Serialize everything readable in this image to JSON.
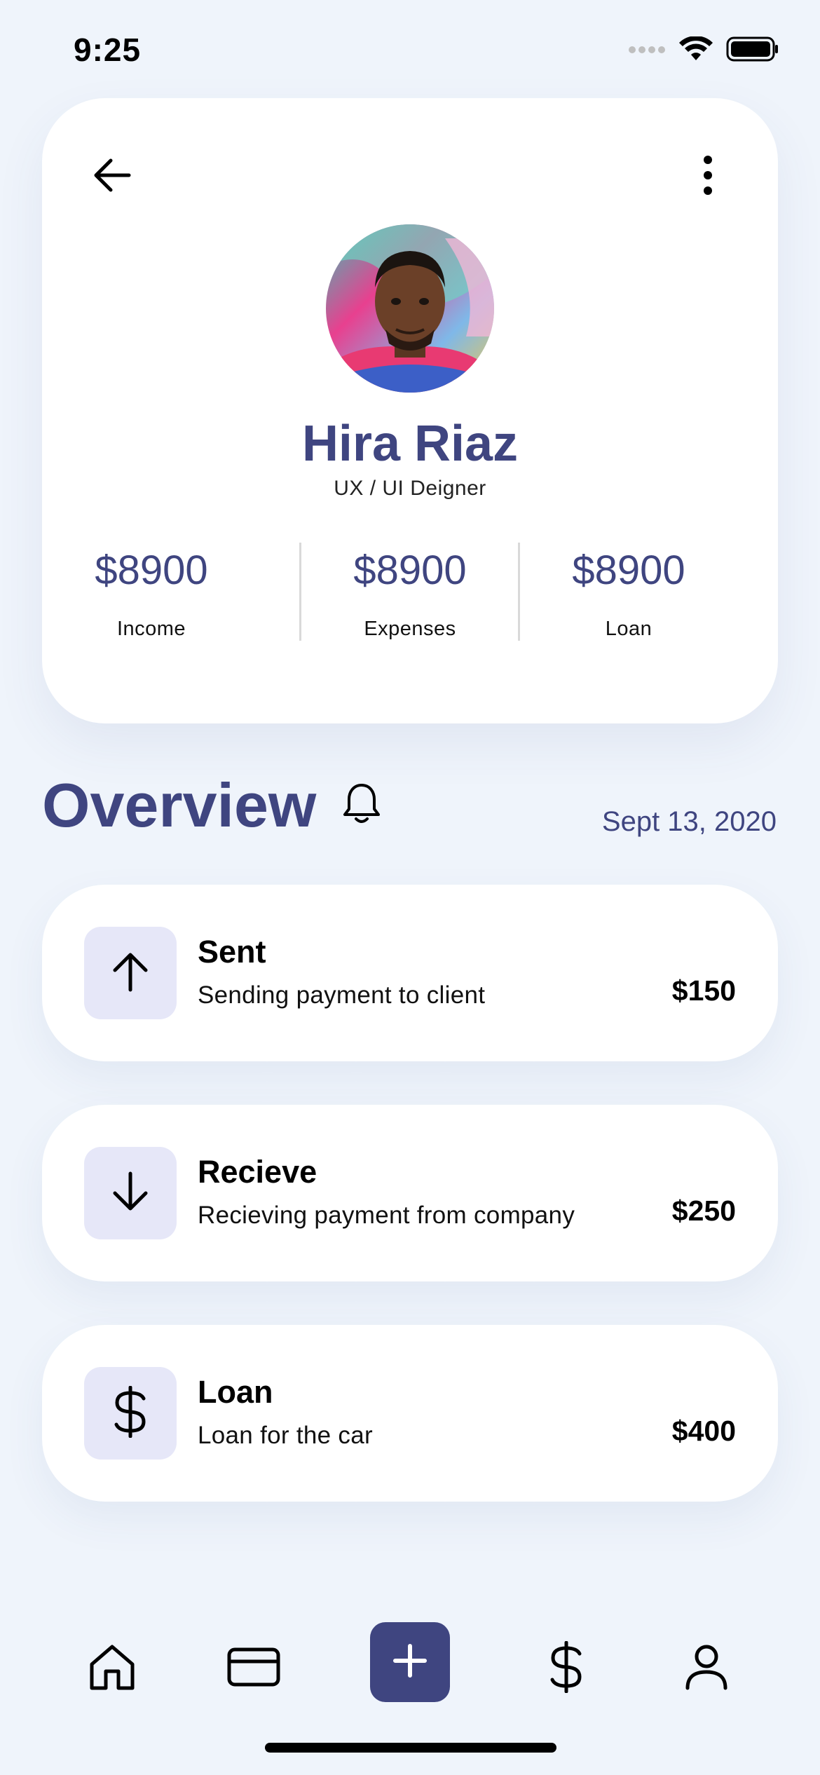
{
  "status_bar": {
    "time": "9:25",
    "icons": [
      "signal-icon",
      "wifi-icon",
      "battery-icon"
    ]
  },
  "profile": {
    "back_icon": "arrow-left-icon",
    "more_icon": "more-vertical-icon",
    "name": "Hira Riaz",
    "role": "UX / UI Deigner",
    "stats": [
      {
        "value": "$8900",
        "label": "Income"
      },
      {
        "value": "$8900",
        "label": "Expenses"
      },
      {
        "value": "$8900",
        "label": "Loan"
      }
    ]
  },
  "overview": {
    "title": "Overview",
    "bell_icon": "bell-icon",
    "date": "Sept 13, 2020"
  },
  "transactions": [
    {
      "icon": "arrow-up-icon",
      "title": "Sent",
      "description": "Sending payment to client",
      "amount": "$150"
    },
    {
      "icon": "arrow-down-icon",
      "title": "Recieve",
      "description": "Recieving payment from company",
      "amount": "$250"
    },
    {
      "icon": "dollar-icon",
      "title": "Loan",
      "description": "Loan for the car",
      "amount": "$400"
    }
  ],
  "bottom_nav": {
    "items": [
      "home-icon",
      "card-icon",
      "plus-icon",
      "dollar-icon",
      "user-icon"
    ]
  },
  "colors": {
    "background": "#eff4fb",
    "accent": "#3f4580",
    "icon_box": "#e6e7f8",
    "card": "#ffffff"
  }
}
